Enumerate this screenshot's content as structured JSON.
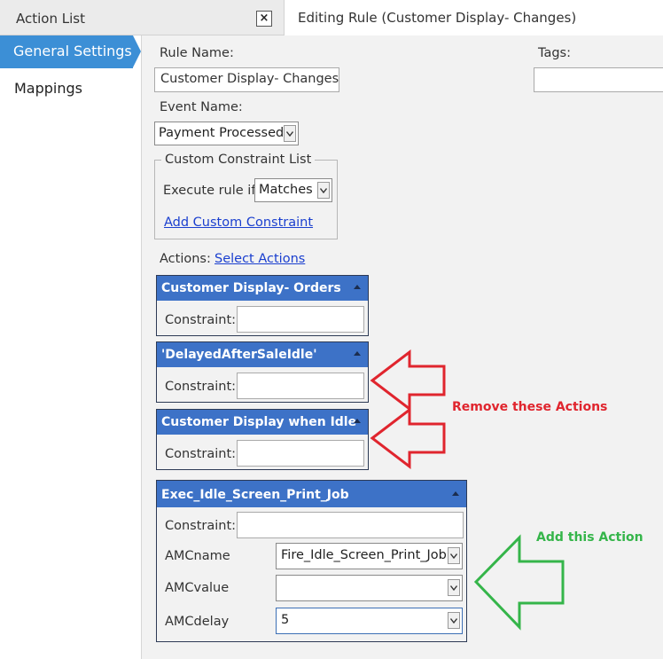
{
  "tabs": {
    "action_list": "Action List",
    "close_glyph": "×",
    "editing": "Editing Rule (Customer Display- Changes)"
  },
  "sidebar": {
    "items": [
      {
        "label": "General Settings",
        "active": true
      },
      {
        "label": "Mappings",
        "active": false
      }
    ]
  },
  "form": {
    "rule_name_label": "Rule Name:",
    "rule_name_value": "Customer Display- Changes",
    "tags_label": "Tags:",
    "tags_value": "",
    "event_name_label": "Event Name:",
    "event_name_value": "Payment Processed",
    "constraint_list": {
      "legend": "Custom Constraint List",
      "execute_label": "Execute rule if",
      "execute_value": "Matches",
      "add_link": "Add Custom Constraint"
    },
    "actions_label": "Actions:",
    "select_actions_link": "Select Actions"
  },
  "actions": [
    {
      "title": "Customer Display- Orders",
      "constraint_label": "Constraint:",
      "constraint_value": ""
    },
    {
      "title": "'DelayedAfterSaleIdle'",
      "constraint_label": "Constraint:",
      "constraint_value": ""
    },
    {
      "title": "Customer Display when Idle",
      "constraint_label": "Constraint:",
      "constraint_value": ""
    },
    {
      "title": "Exec_Idle_Screen_Print_Job",
      "constraint_label": "Constraint:",
      "constraint_value": "",
      "params": [
        {
          "label": "AMCname",
          "value": "Fire_Idle_Screen_Print_Job"
        },
        {
          "label": "AMCvalue",
          "value": ""
        },
        {
          "label": "AMCdelay",
          "value": "5"
        }
      ]
    }
  ],
  "annotations": {
    "remove": "Remove these Actions",
    "add": "Add this Action",
    "red": "#e0252e",
    "green": "#35b54a"
  },
  "colors": {
    "accent": "#3c8fd6",
    "panel_header": "#3d72c7",
    "link": "#1a3fcf"
  }
}
